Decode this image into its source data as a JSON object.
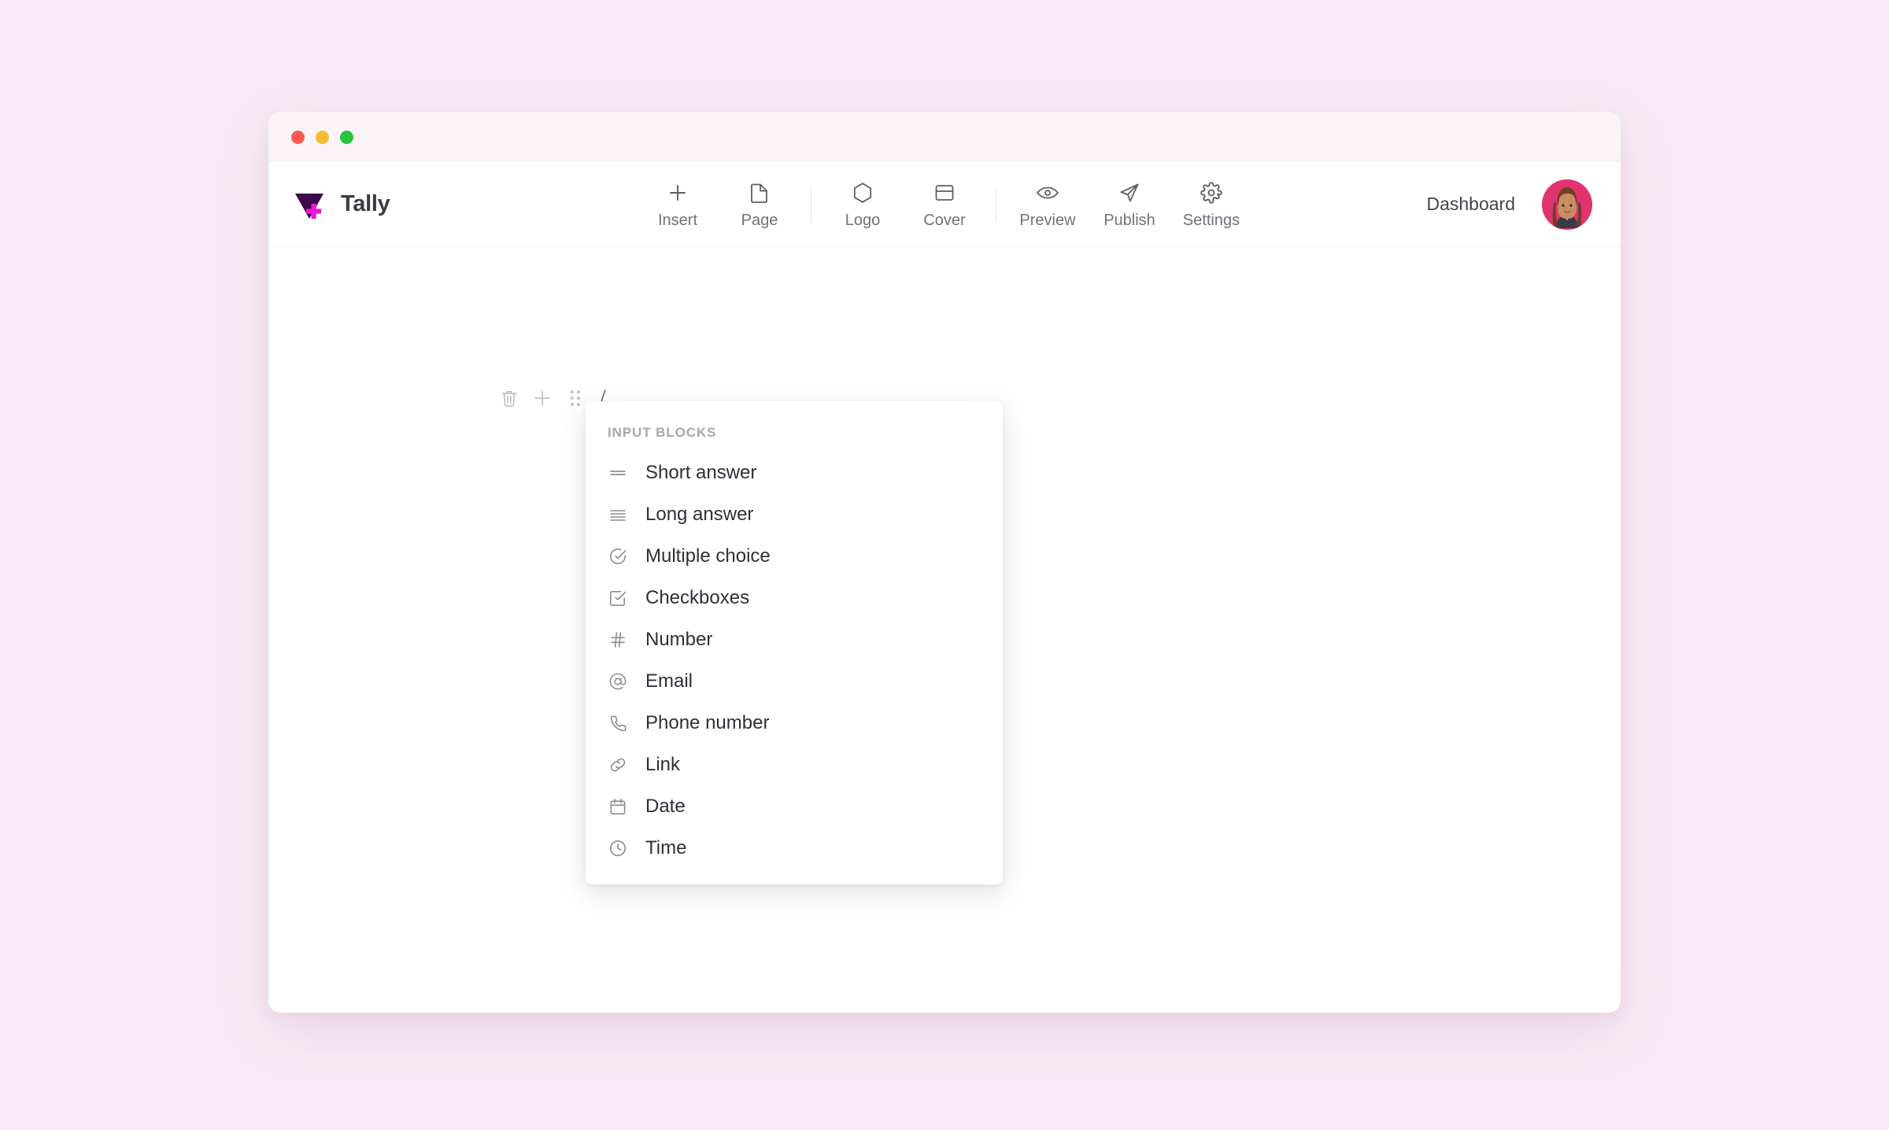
{
  "window": {
    "traffic_lights": [
      {
        "name": "close",
        "color": "#fb5a52"
      },
      {
        "name": "minimize",
        "color": "#f6bc31"
      },
      {
        "name": "maximize",
        "color": "#2ac33e"
      }
    ]
  },
  "brand": {
    "name": "Tally",
    "logo_icon": "tally-triangle-plus-logo",
    "triangle_color": "#3d0b4d",
    "plus_color": "#f215d6"
  },
  "toolbar": {
    "groups": [
      {
        "items": [
          {
            "label": "Insert",
            "icon": "plus-icon"
          },
          {
            "label": "Page",
            "icon": "page-icon"
          }
        ]
      },
      {
        "items": [
          {
            "label": "Logo",
            "icon": "hexagon-icon"
          },
          {
            "label": "Cover",
            "icon": "cover-icon"
          }
        ]
      },
      {
        "items": [
          {
            "label": "Preview",
            "icon": "eye-icon"
          },
          {
            "label": "Publish",
            "icon": "paper-plane-icon"
          },
          {
            "label": "Settings",
            "icon": "gear-icon"
          }
        ]
      }
    ]
  },
  "header_right": {
    "dashboard_label": "Dashboard",
    "avatar_name": "user-avatar",
    "avatar_bg": "#e2336f"
  },
  "editor": {
    "block_controls": [
      {
        "name": "delete-block",
        "icon": "trash-icon"
      },
      {
        "name": "add-block",
        "icon": "plus-icon"
      },
      {
        "name": "drag-handle",
        "icon": "drag-dots-icon"
      }
    ],
    "block_text": "/"
  },
  "slash_menu": {
    "heading": "INPUT BLOCKS",
    "items": [
      {
        "label": "Short answer",
        "icon": "two-lines-icon"
      },
      {
        "label": "Long answer",
        "icon": "four-lines-icon"
      },
      {
        "label": "Multiple choice",
        "icon": "circle-check-icon"
      },
      {
        "label": "Checkboxes",
        "icon": "square-check-icon"
      },
      {
        "label": "Number",
        "icon": "hash-icon"
      },
      {
        "label": "Email",
        "icon": "at-sign-icon"
      },
      {
        "label": "Phone number",
        "icon": "phone-icon"
      },
      {
        "label": "Link",
        "icon": "link-icon"
      },
      {
        "label": "Date",
        "icon": "calendar-icon"
      },
      {
        "label": "Time",
        "icon": "clock-icon"
      }
    ]
  },
  "theme": {
    "page_background": "#f8eaf4",
    "titlebar_background": "#faf4f7",
    "app_background": "#ffffff"
  }
}
